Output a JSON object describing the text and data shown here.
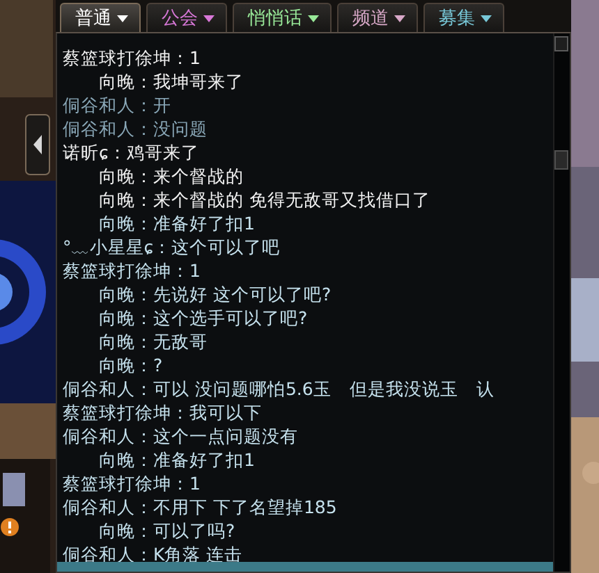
{
  "tabs": [
    {
      "label": "普通",
      "selected": true,
      "color": "#ffffff"
    },
    {
      "label": "公会",
      "selected": false,
      "color": "#d878d8"
    },
    {
      "label": "悄悄话",
      "selected": false,
      "color": "#98e898"
    },
    {
      "label": "频道",
      "selected": false,
      "color": "#d8a8c8"
    },
    {
      "label": "募集",
      "selected": false,
      "color": "#78c8d8"
    }
  ],
  "chat": [
    {
      "text": "蔡篮球打徐坤：1",
      "color": "#f2f2f2"
    },
    {
      "text": "　　向晚：我坤哥来了",
      "color": "#f2f2f2"
    },
    {
      "text": "侗谷和人：开",
      "color": "#8aa8b8"
    },
    {
      "text": "侗谷和人：没问题",
      "color": "#8aa8b8"
    },
    {
      "text": "诺昕ɕ：鸡哥来了",
      "color": "#f2f2f2"
    },
    {
      "text": "　　向晚：来个督战的",
      "color": "#f2f2f2"
    },
    {
      "text": "　　向晚：来个督战的 免得无敌哥又找借口了",
      "color": "#f2f2f2"
    },
    {
      "text": "　　向晚：准备好了扣1",
      "color": "#c6e2ee"
    },
    {
      "text": "°﹏小星星ɕ：这个可以了吧",
      "color": "#c6e2ee"
    },
    {
      "text": "蔡篮球打徐坤：1",
      "color": "#c6e2ee"
    },
    {
      "text": "　　向晚：先说好 这个可以了吧?",
      "color": "#c6e2ee"
    },
    {
      "text": "　　向晚：这个选手可以了吧?",
      "color": "#c6e2ee"
    },
    {
      "text": "　　向晚：无敌哥",
      "color": "#c6e2ee"
    },
    {
      "text": "　　向晚：?",
      "color": "#c6e2ee"
    },
    {
      "text": "侗谷和人：可以 没问题哪怕5.6玉　但是我没说玉　认",
      "color": "#c6e2ee"
    },
    {
      "text": "蔡篮球打徐坤：我可以下",
      "color": "#c6e2ee"
    },
    {
      "text": "侗谷和人：这个一点问题没有",
      "color": "#c6e2ee"
    },
    {
      "text": "　　向晚：准备好了扣1",
      "color": "#c6e2ee"
    },
    {
      "text": "蔡篮球打徐坤：1",
      "color": "#c6e2ee"
    },
    {
      "text": "侗谷和人：不用下 下了名望掉185",
      "color": "#c6e2ee"
    },
    {
      "text": "　　向晚：可以了吗?",
      "color": "#c6e2ee"
    },
    {
      "text": "侗谷和人：K角落 连击",
      "color": "#c6e2ee"
    }
  ]
}
